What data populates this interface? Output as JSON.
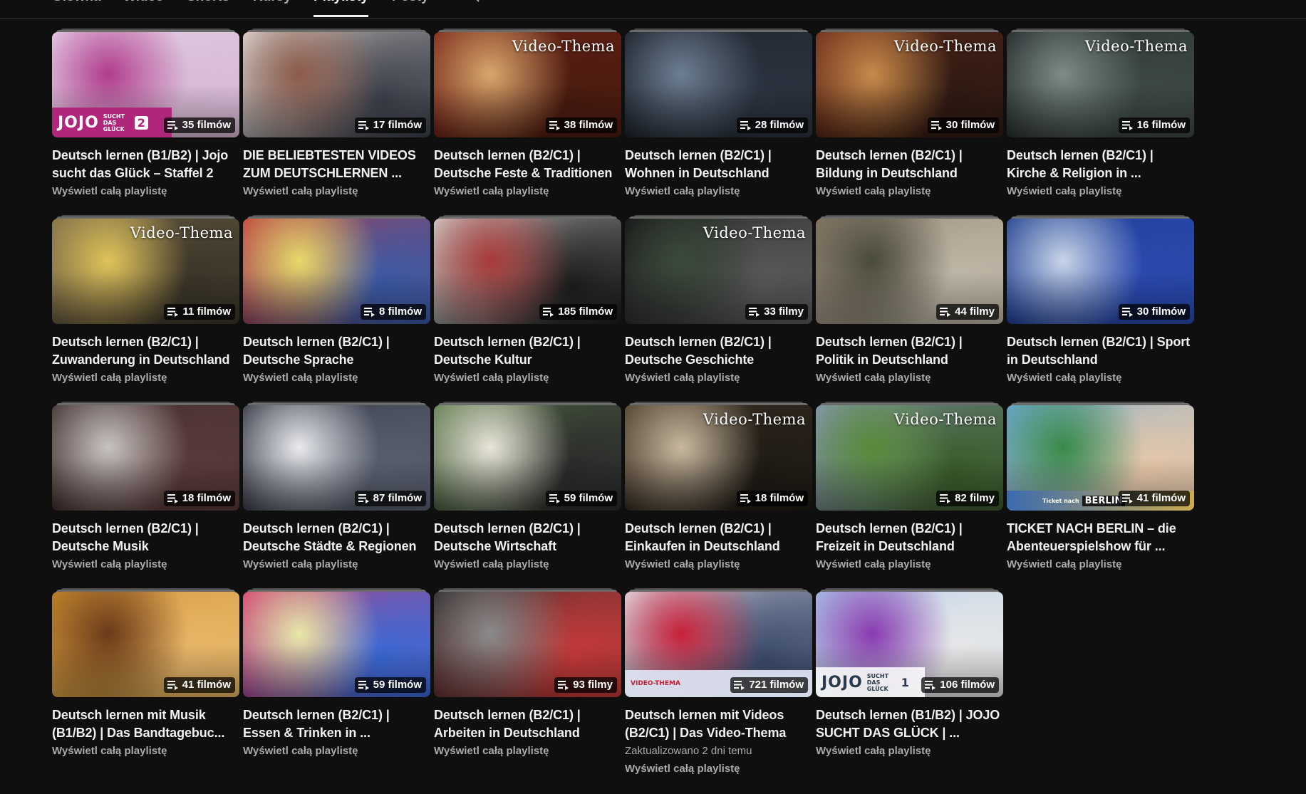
{
  "tabs": [
    {
      "label": "Główna",
      "active": false
    },
    {
      "label": "Wideo",
      "active": false
    },
    {
      "label": "Shorts",
      "active": false
    },
    {
      "label": "Kursy",
      "active": false
    },
    {
      "label": "Playlisty",
      "active": true
    },
    {
      "label": "Posty",
      "active": false
    }
  ],
  "icons": {
    "search": "search-icon",
    "playlist": "playlist-icon"
  },
  "playlists": [
    {
      "title": "Deutsch lernen (B1/B2) | Jojo sucht das Glück – Staffel 2",
      "count": "35 filmów",
      "link": "Wyświetl całą playlistę",
      "overlay": "",
      "logo": "JOJO",
      "logo_tag": "SUCHT DAS GLÜCK",
      "logo_num": "2",
      "colors": [
        "#e9d9ec",
        "#b03c8c",
        "#d7b9d4"
      ]
    },
    {
      "title": "DIE BELIEBTESTEN VIDEOS ZUM DEUTSCHLERNEN ...",
      "count": "17 filmów",
      "link": "Wyświetl całą playlistę",
      "overlay": "",
      "colors": [
        "#e5e0da",
        "#8c5a4a",
        "#3c3f4a"
      ]
    },
    {
      "title": "Deutsch lernen (B2/C1) | Deutsche Feste & Traditionen",
      "count": "38 filmów",
      "link": "Wyświetl całą playlistę",
      "overlay": "Video-Thema",
      "colors": [
        "#7a2418",
        "#d7a76c",
        "#4a1b10"
      ]
    },
    {
      "title": "Deutsch lernen (B2/C1) | Wohnen in Deutschland",
      "count": "28 filmów",
      "link": "Wyświetl całą playlistę",
      "overlay": "",
      "colors": [
        "#161b22",
        "#6d7f93",
        "#2b3440"
      ]
    },
    {
      "title": "Deutsch lernen (B2/C1) | Bildung in Deutschland",
      "count": "30 filmów",
      "link": "Wyświetl całą playlistę",
      "overlay": "Video-Thema",
      "colors": [
        "#6b2a1a",
        "#c68a4a",
        "#2e1a12"
      ]
    },
    {
      "title": "Deutsch lernen (B2/C1) | Kirche & Religion in ...",
      "count": "16 filmów",
      "link": "Wyświetl całą playlistę",
      "overlay": "Video-Thema",
      "colors": [
        "#1e2327",
        "#7c8c86",
        "#3e4a44"
      ]
    },
    {
      "title": "Deutsch lernen (B2/C1) | Zuwanderung in Deutschland",
      "count": "11 filmów",
      "link": "Wyświetl całą playlistę",
      "overlay": "Video-Thema",
      "colors": [
        "#7a6a4a",
        "#e0c35a",
        "#3a3428"
      ]
    },
    {
      "title": "Deutsch lernen (B2/C1) | Deutsche Sprache",
      "count": "8 filmów",
      "link": "Wyświetl całą playlistę",
      "overlay": "",
      "colors": [
        "#c03a3a",
        "#e8d96a",
        "#3a5aa8"
      ]
    },
    {
      "title": "Deutsch lernen (B2/C1) | Deutsche Kultur",
      "count": "185 filmów",
      "link": "Wyświetl całą playlistę",
      "overlay": "",
      "colors": [
        "#d8d6d2",
        "#a83a3a",
        "#1c1c1c"
      ]
    },
    {
      "title": "Deutsch lernen (B2/C1) | Deutsche Geschichte",
      "count": "33 filmy",
      "link": "Wyświetl całą playlistę",
      "overlay": "Video-Thema",
      "colors": [
        "#141414",
        "#3a4a3a",
        "#5a5a5a"
      ]
    },
    {
      "title": "Deutsch lernen (B2/C1) | Politik in Deutschland",
      "count": "44 filmy",
      "link": "Wyświetl całą playlistę",
      "overlay": "",
      "colors": [
        "#8a7a6a",
        "#4a4a3a",
        "#c0b8a8"
      ]
    },
    {
      "title": "Deutsch lernen (B2/C1) | Sport in Deutschland",
      "count": "30 filmów",
      "link": "Wyświetl całą playlistę",
      "overlay": "",
      "colors": [
        "#1a3a8a",
        "#c8d4e8",
        "#2a4ab0"
      ]
    },
    {
      "title": "Deutsch lernen (B2/C1) | Deutsche Musik",
      "count": "18 filmów",
      "link": "Wyświetl całą playlistę",
      "overlay": "",
      "colors": [
        "#3a2a2a",
        "#c8c4c0",
        "#5a3a3a"
      ]
    },
    {
      "title": "Deutsch lernen (B2/C1) | Deutsche Städte & Regionen",
      "count": "87 filmów",
      "link": "Wyświetl całą playlistę",
      "overlay": "",
      "colors": [
        "#2a2e3a",
        "#e8eaee",
        "#5a6070"
      ]
    },
    {
      "title": "Deutsch lernen (B2/C1) | Deutsche Wirtschaft",
      "count": "59 filmów",
      "link": "Wyświetl całą playlistę",
      "overlay": "",
      "colors": [
        "#5a7a4a",
        "#e8e4d8",
        "#2a2a2a"
      ]
    },
    {
      "title": "Deutsch lernen (B2/C1) | Einkaufen in Deutschland",
      "count": "18 filmów",
      "link": "Wyświetl całą playlistę",
      "overlay": "Video-Thema",
      "colors": [
        "#4a3a2a",
        "#c8b8a0",
        "#1e1a14"
      ]
    },
    {
      "title": "Deutsch lernen (B2/C1) | Freizeit in Deutschland",
      "count": "82 filmy",
      "link": "Wyświetl całą playlistę",
      "overlay": "Video-Thema",
      "colors": [
        "#8a9ab8",
        "#5a8a3a",
        "#3a5a2a"
      ]
    },
    {
      "title": "TICKET NACH BERLIN – die Abenteuerspielshow für ...",
      "count": "41 filmów",
      "link": "Wyświetl całą playlistę",
      "overlay": "",
      "logo": "BERLIN",
      "logo_tag": "Ticket nach",
      "colors": [
        "#6aa8d8",
        "#3a8a4a",
        "#e8c8a8"
      ]
    },
    {
      "title": "Deutsch lernen mit Musik (B1/B2) | Das Bandtagebuc...",
      "count": "41 filmów",
      "link": "Wyświetl całą playlistę",
      "overlay": "",
      "colors": [
        "#c88a2a",
        "#6a3a1a",
        "#e8b86a"
      ]
    },
    {
      "title": "Deutsch lernen (B2/C1) | Essen & Trinken in ...",
      "count": "59 filmów",
      "link": "Wyświetl całą playlistę",
      "overlay": "",
      "colors": [
        "#d83a6a",
        "#e8e8a8",
        "#3a6ad8"
      ]
    },
    {
      "title": "Deutsch lernen (B2/C1) | Arbeiten in Deutschland",
      "count": "93 filmy",
      "link": "Wyświetl całą playlistę",
      "overlay": "",
      "colors": [
        "#2a2a2a",
        "#8a8a8a",
        "#c83a3a"
      ]
    },
    {
      "title": "Deutsch lernen mit Videos (B2/C1) | Das Video-Thema",
      "count": "721 filmów",
      "link": "Wyświetl całą playlistę",
      "meta": "Zaktualizowano 2 dni temu",
      "overlay": "",
      "logo": "VIDEO-THEMA",
      "colors": [
        "#e8e8ee",
        "#c8203a",
        "#3a4a6a"
      ]
    },
    {
      "title": "Deutsch lernen (B1/B2) | JOJO SUCHT DAS GLÜCK | ...",
      "count": "106 filmów",
      "link": "Wyświetl całą playlistę",
      "overlay": "",
      "logo": "JOJO",
      "logo_tag": "SUCHT DAS GLÜCK",
      "logo_num": "1",
      "colors": [
        "#a8c8e8",
        "#8a3ab0",
        "#e8e8e8"
      ]
    }
  ]
}
